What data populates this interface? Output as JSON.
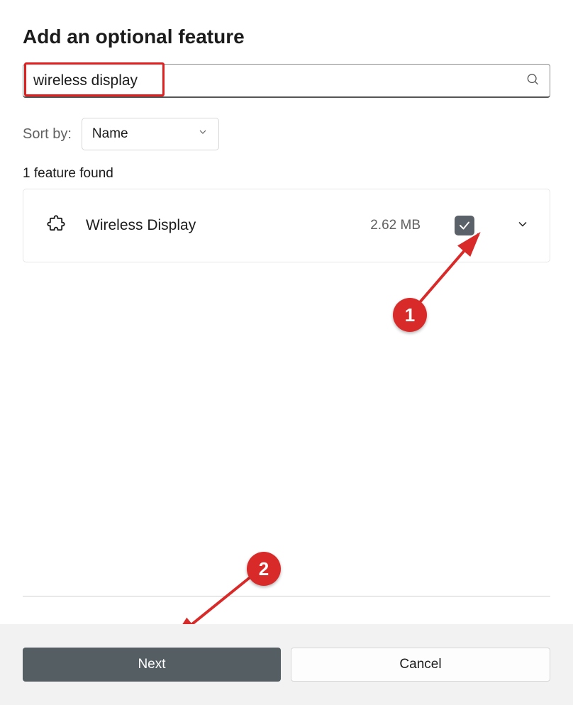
{
  "title": "Add an optional feature",
  "search": {
    "value": "wireless display"
  },
  "sort": {
    "label": "Sort by:",
    "selected": "Name"
  },
  "results": {
    "count_text": "1 feature found"
  },
  "feature": {
    "name": "Wireless Display",
    "size": "2.62 MB",
    "checked": true
  },
  "footer": {
    "next": "Next",
    "cancel": "Cancel"
  },
  "annotations": {
    "badge1": "1",
    "badge2": "2"
  }
}
